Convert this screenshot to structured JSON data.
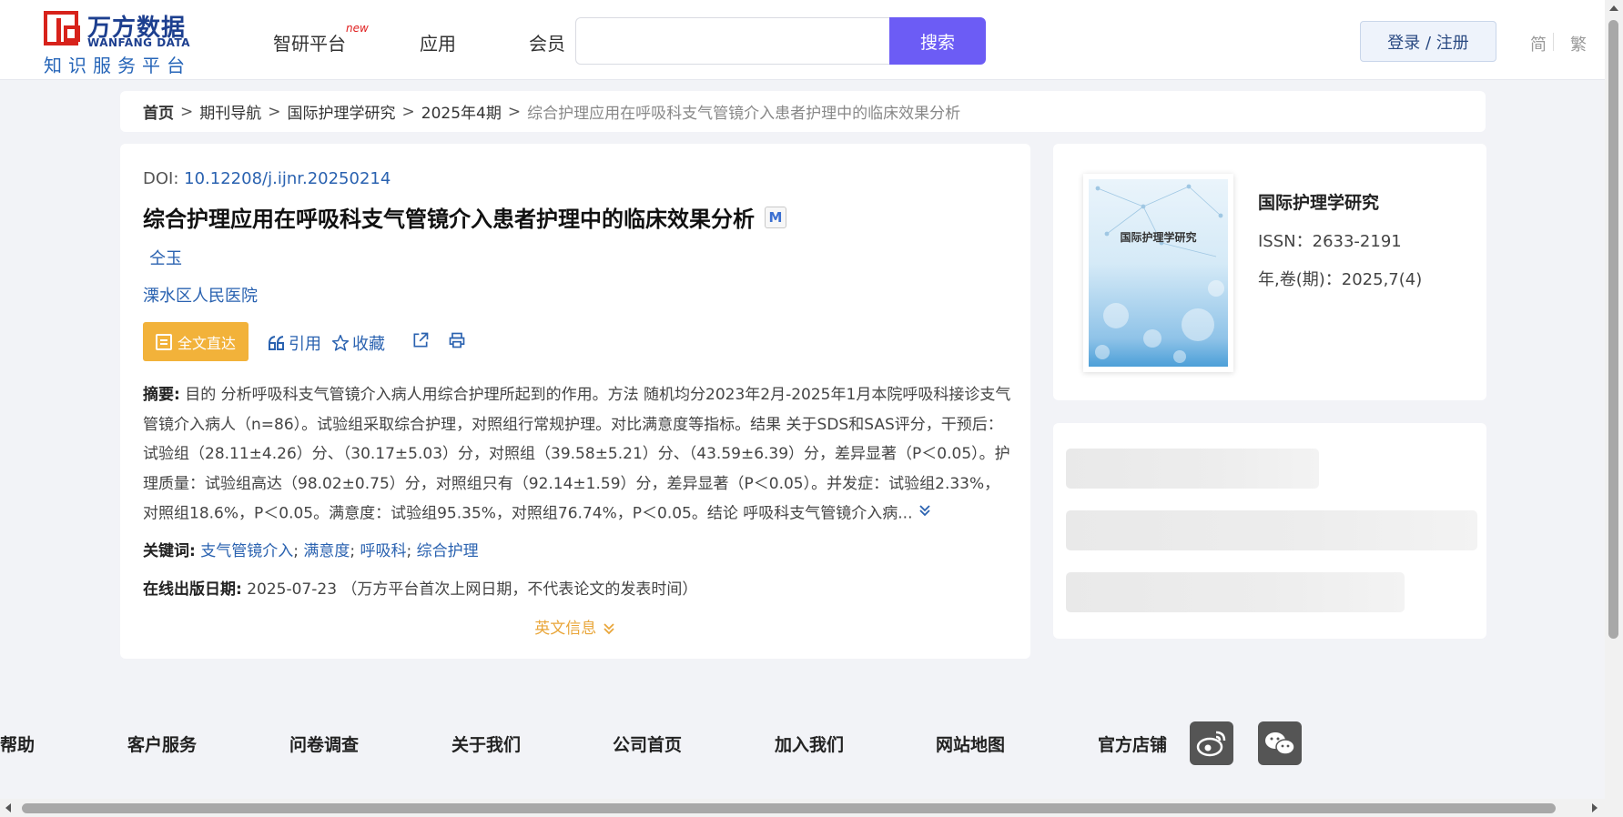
{
  "header": {
    "logo_cn": "万方数据",
    "logo_en": "WANFANG DATA",
    "logo_sub": "知识服务平台",
    "nav": [
      {
        "label": "智研平台",
        "badge": "new"
      },
      {
        "label": "应用"
      },
      {
        "label": "会员"
      }
    ],
    "search_placeholder": "",
    "search_button": "搜索",
    "login_button": "登录 / 注册",
    "lang_simplified": "简",
    "lang_traditional": "繁"
  },
  "breadcrumb": {
    "home": "首页",
    "items": [
      "期刊导航",
      "国际护理学研究",
      "2025年4期"
    ],
    "current": "综合护理应用在呼吸科支气管镜介入患者护理中的临床效果分析",
    "separator": ">"
  },
  "article": {
    "doi_label": "DOI:",
    "doi_value": "10.12208/j.ijnr.20250214",
    "title": "综合护理应用在呼吸科支气管镜介入患者护理中的临床效果分析",
    "badge": "M",
    "author": "仝玉",
    "organization": "溧水区人民医院",
    "actions": {
      "fulltext": "全文直达",
      "cite": "引用",
      "favorite": "收藏"
    },
    "abstract_label": "摘要:",
    "abstract_text": "目的 分析呼吸科支气管镜介入病人用综合护理所起到的作用。方法 随机均分2023年2月-2025年1月本院呼吸科接诊支气管镜介入病人（n=86）。试验组采取综合护理，对照组行常规护理。对比满意度等指标。结果 关于SDS和SAS评分，干预后：试验组（28.11±4.26）分、（30.17±5.03）分，对照组（39.58±5.21）分、（43.59±6.39）分，差异显著（P＜0.05）。护理质量：试验组高达（98.02±0.75）分，对照组只有（92.14±1.59）分，差异显著（P＜0.05）。并发症：试验组2.33%，对照组18.6%，P＜0.05。满意度：试验组95.35%，对照组76.74%，P＜0.05。结论 呼吸科支气管镜介入病...",
    "keywords_label": "关键词:",
    "keywords": [
      "支气管镜介入",
      "满意度",
      "呼吸科",
      "综合护理"
    ],
    "keyword_sep": ";",
    "pubdate_label": "在线出版日期:",
    "pubdate_value": "2025-07-23",
    "pubdate_note": "（万方平台首次上网日期，不代表论文的发表时间）",
    "english_toggle": "英文信息"
  },
  "journal": {
    "cover_title": "国际护理学研究",
    "name": "国际护理学研究",
    "issn": "ISSN：2633-2191",
    "volume": "年,卷(期)：2025,7(4)"
  },
  "footer": {
    "links": [
      "帮助",
      "客户服务",
      "问卷调查",
      "关于我们",
      "公司首页",
      "加入我们",
      "网站地图",
      "官方店铺"
    ],
    "social": [
      "weibo-icon",
      "wechat-icon"
    ]
  },
  "colors": {
    "accent": "#6c5cf5",
    "link": "#2a62b0",
    "fulltext": "#f2b23a",
    "brand_red": "#d7221b",
    "brand_blue": "#1d3f8f"
  }
}
